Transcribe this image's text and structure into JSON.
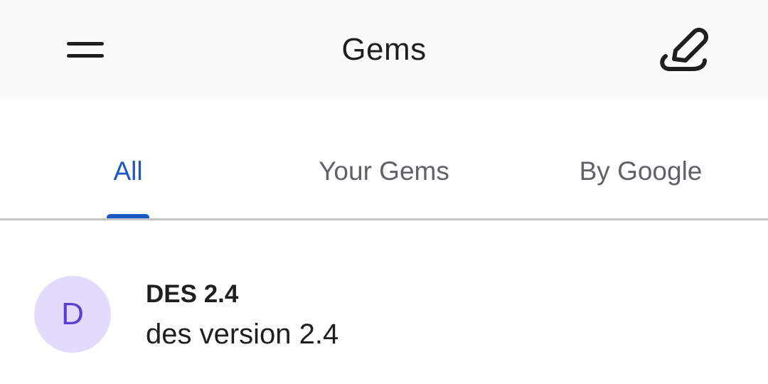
{
  "app_bar": {
    "title": "Gems",
    "menu_icon": "hamburger-menu-icon",
    "edit_icon": "new-gem-edit-icon"
  },
  "tabs": [
    {
      "label": "All",
      "active": true
    },
    {
      "label": "Your Gems",
      "active": false
    },
    {
      "label": "By Google",
      "active": false
    }
  ],
  "colors": {
    "accent": "#1a56c4",
    "avatar_bg": "#e3dbfb",
    "avatar_fg": "#5b3fd2",
    "text": "#1f1f1f",
    "muted": "#5f6368"
  },
  "gems": [
    {
      "initial": "D",
      "name": "DES 2.4",
      "description": "des version 2.4"
    }
  ]
}
